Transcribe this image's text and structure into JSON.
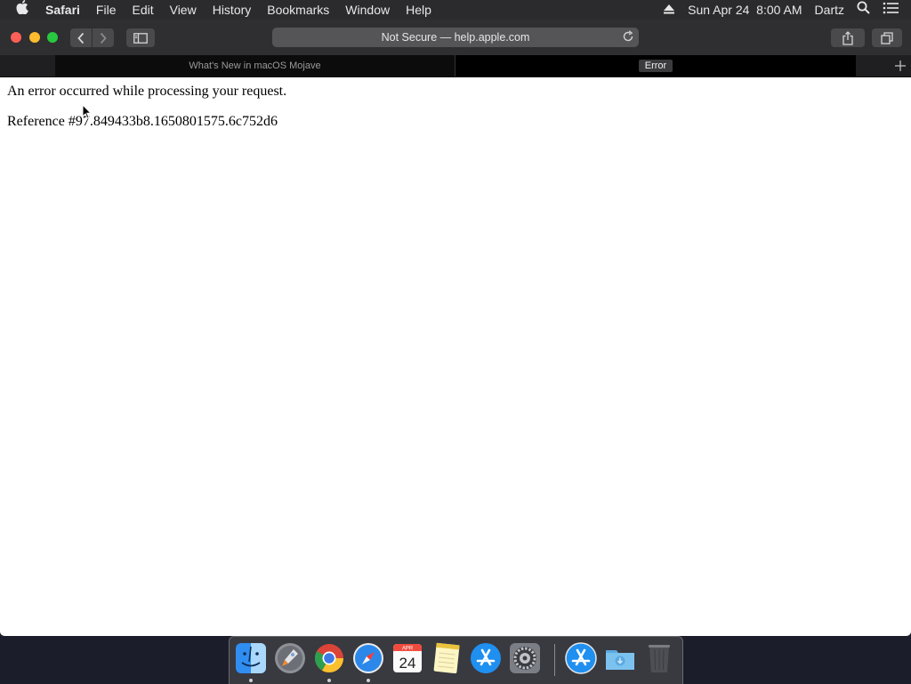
{
  "menubar": {
    "app": "Safari",
    "items": [
      "File",
      "Edit",
      "View",
      "History",
      "Bookmarks",
      "Window",
      "Help"
    ],
    "datetime": "Sun Apr 24  8:00 AM",
    "user": "Dartz"
  },
  "toolbar": {
    "address": "Not Secure — help.apple.com"
  },
  "tabs": [
    {
      "title": "What's New in macOS Mojave"
    },
    {
      "title": "Error"
    }
  ],
  "page": {
    "message": "An error occurred while processing your request.",
    "reference": "Reference #97.849433b8.1650801575.6c752d6"
  },
  "dock": {
    "calendar": {
      "month": "APR",
      "day": "24"
    }
  },
  "colors": {
    "close": "#fe5f57",
    "minimize": "#febc2e",
    "zoom": "#28c840"
  }
}
